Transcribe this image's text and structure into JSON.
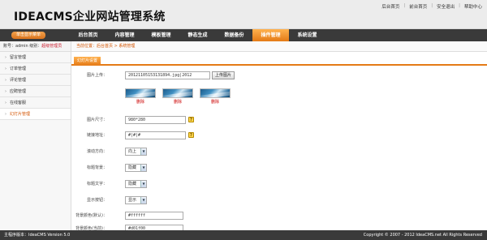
{
  "header": {
    "logo": "IDEACMS企业网站管理系统",
    "links": [
      "后台首页",
      "前台首页",
      "安全退出",
      "帮助中心"
    ]
  },
  "nav": {
    "quick_label": "单击显示菜单",
    "menu": [
      "后台首页",
      "内容管理",
      "模板管理",
      "静态生成",
      "数据备份",
      "插件管理",
      "系统设置"
    ],
    "active_index": 5
  },
  "user": {
    "prefix": "账号：admin",
    "role_prefix": "级别：",
    "role": "超级管理员"
  },
  "breadcrumb": "当前位置：后台首页 > 系统管理",
  "sidebar": {
    "items": [
      "留言管理",
      "订单管理",
      "评论管理",
      "应聘管理",
      "在线客服",
      "幻灯片管理"
    ],
    "active_index": 5
  },
  "tab": {
    "label": "幻灯片设置"
  },
  "form": {
    "upload_label": "图片上传：",
    "upload_value": "20121105153131894.jpg|2012",
    "upload_button": "上传图片",
    "thumbs": [
      {
        "delete": "删除"
      },
      {
        "delete": "删除"
      },
      {
        "delete": "删除"
      }
    ],
    "size_label": "图片尺寸：",
    "size_value": "980*280",
    "link_label": "链接地址：",
    "link_value": "#|#|#",
    "direction_label": "滚动方向：",
    "direction_value": "向上",
    "title_bg_label": "标题背景：",
    "title_bg_value": "隐藏",
    "title_text_label": "标题文字：",
    "title_text_value": "隐藏",
    "buttons_label": "显示按钮：",
    "buttons_value": "显示",
    "bg_default_label": "背景颜色(默认)：",
    "bg_default_value": "#ffffff",
    "bg_current_label": "背景颜色(当前)：",
    "bg_current_value": "#d01f00"
  },
  "footer": {
    "version": "主程序版本：IdeaCMS Version 5.0",
    "copyright": "Copyright © 2007 - 2012 IdeaCMS.net All Rights Reserved"
  },
  "colors": {
    "accent": "#e47a16",
    "nav_bg": "#3a3a3a",
    "delete": "#cc0000"
  },
  "icons": {
    "help": "help-icon",
    "dropdown": "chevron-down-icon",
    "sidebar_bullet": "arrow-right-icon"
  }
}
